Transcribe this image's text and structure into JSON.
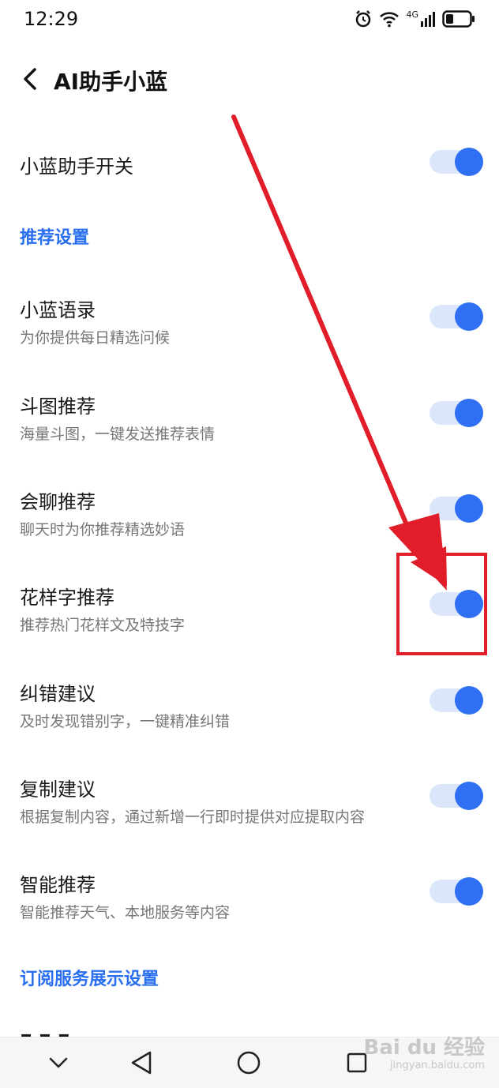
{
  "status_bar": {
    "time": "12:29",
    "network": "4G",
    "icons": [
      "alarm-icon",
      "wifi-icon",
      "signal-icon",
      "battery-icon"
    ]
  },
  "header": {
    "title": "AI助手小蓝",
    "back_icon": "chevron-left-icon"
  },
  "main_toggle": {
    "title": "小蓝助手开关",
    "enabled": true
  },
  "sections": [
    {
      "header": "推荐设置",
      "items": [
        {
          "title": "小蓝语录",
          "subtitle": "为你提供每日精选问候",
          "enabled": true
        },
        {
          "title": "斗图推荐",
          "subtitle": "海量斗图，一键发送推荐表情",
          "enabled": true
        },
        {
          "title": "会聊推荐",
          "subtitle": "聊天时为你推荐精选妙语",
          "enabled": true
        },
        {
          "title": "花样字推荐",
          "subtitle": "推荐热门花样文及特技字",
          "enabled": true
        },
        {
          "title": "纠错建议",
          "subtitle": "及时发现错别字，一键精准纠错",
          "enabled": true
        },
        {
          "title": "复制建议",
          "subtitle": "根据复制内容，通过新增一行即时提供对应提取内容",
          "enabled": true
        },
        {
          "title": "智能推荐",
          "subtitle": "智能推荐天气、本地服务等内容",
          "enabled": true
        }
      ]
    },
    {
      "header": "订阅服务展示设置",
      "items": []
    }
  ],
  "nav_bar": {
    "buttons": [
      "chevron-down-icon",
      "back-triangle-icon",
      "home-circle-icon",
      "recents-square-icon"
    ]
  },
  "watermark": {
    "logo": "Bai du 经验",
    "url": "jingyan.baidu.com"
  },
  "colors": {
    "accent": "#2f6ff3",
    "section_header": "#2a6ff0",
    "toggle_track": "#dbe6fb",
    "annotation": "#e21d2a"
  }
}
